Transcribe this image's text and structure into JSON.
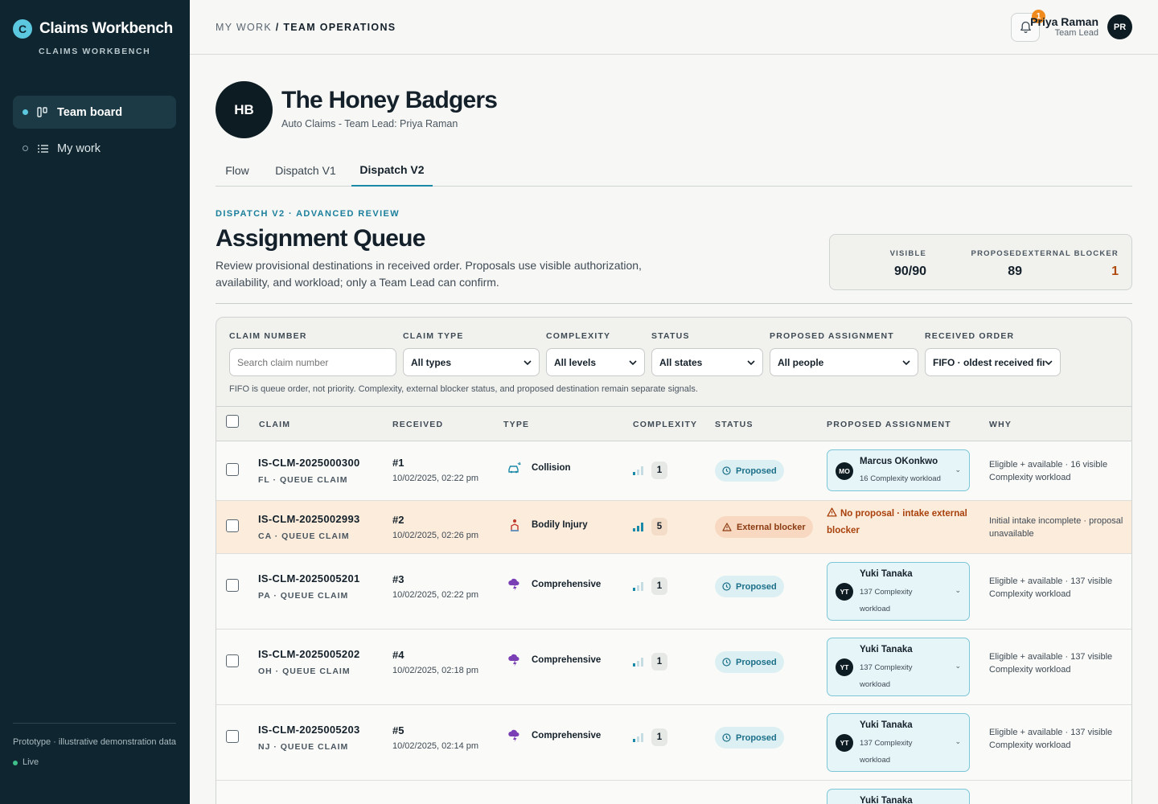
{
  "app": {
    "logo_letter": "C",
    "title": "Claims Workbench",
    "subtitle": "CLAIMS WORKBENCH"
  },
  "sidebar": {
    "items": [
      {
        "label": "Team board",
        "icon": "board-icon",
        "active": true
      },
      {
        "label": "My work",
        "icon": "list-icon",
        "active": false
      }
    ],
    "footer_note": "Prototype · illustrative demonstration data",
    "status": "Live"
  },
  "topbar": {
    "crumb_root": "MY WORK",
    "crumb_sep": " / ",
    "crumb_current": "TEAM OPERATIONS",
    "notifications": "1",
    "user_name": "Priya Raman",
    "user_role": "Team Lead",
    "user_initials": "PR"
  },
  "team": {
    "initials": "HB",
    "name": "The Honey Badgers",
    "subtitle": "Auto Claims - Team Lead: Priya Raman"
  },
  "tabs": [
    {
      "label": "Flow"
    },
    {
      "label": "Dispatch V1"
    },
    {
      "label": "Dispatch V2",
      "active": true
    }
  ],
  "section": {
    "eyebrow": "DISPATCH V2 · ADVANCED REVIEW",
    "title": "Assignment Queue",
    "description": "Review provisional destinations in received order. Proposals use visible authorization, availability, and workload; only a Team Lead can confirm."
  },
  "stats": [
    {
      "label": "VISIBLE",
      "value": "90/90",
      "color": "#14202a"
    },
    {
      "label": "PROPOSED",
      "value": "89",
      "color": "#14202a"
    },
    {
      "label": "EXTERNAL BLOCKER",
      "value": "1",
      "color": "#b04a0c"
    }
  ],
  "filters": {
    "claim_number": {
      "label": "CLAIM NUMBER",
      "placeholder": "Search claim number"
    },
    "claim_type": {
      "label": "CLAIM TYPE",
      "value": "All types"
    },
    "complexity": {
      "label": "COMPLEXITY",
      "value": "All levels"
    },
    "status": {
      "label": "STATUS",
      "value": "All states"
    },
    "proposed": {
      "label": "PROPOSED ASSIGNMENT",
      "value": "All people"
    },
    "order": {
      "label": "RECEIVED ORDER",
      "value": "FIFO · oldest received fir"
    },
    "note": "FIFO is queue order, not priority. Complexity, external blocker status, and proposed destination remain separate signals."
  },
  "table": {
    "headers": [
      "CLAIM",
      "RECEIVED",
      "TYPE",
      "COMPLEXITY",
      "STATUS",
      "PROPOSED ASSIGNMENT",
      "WHY"
    ],
    "rows": [
      {
        "claim": "IS-CLM-2025000300",
        "sub": "FL · QUEUE CLAIM",
        "num": "#1",
        "date": "10/02/2025, 02:22 pm",
        "type": "Collision",
        "type_icon": "car-icon",
        "complexity": "1",
        "status": "Proposed",
        "assignee": "Marcus OKonkwo",
        "initials": "MO",
        "load": "16 Complexity workload",
        "why": "Eligible + available · 16 visible\nComplexity workload"
      },
      {
        "claim": "IS-CLM-2025002993",
        "sub": "CA · QUEUE CLAIM",
        "num": "#2",
        "date": "10/02/2025, 02:26 pm",
        "type": "Bodily Injury",
        "type_icon": "injury-icon",
        "complexity": "5",
        "status": "External blocker",
        "note": "No proposal · intake external blocker",
        "why": "Initial intake incomplete · proposal\nunavailable"
      },
      {
        "claim": "IS-CLM-2025005201",
        "sub": "PA · QUEUE CLAIM",
        "num": "#3",
        "date": "10/02/2025, 02:22 pm",
        "type": "Comprehensive",
        "type_icon": "storm-icon",
        "complexity": "1",
        "status": "Proposed",
        "assignee": "Yuki Tanaka",
        "initials": "YT",
        "load": "137 Complexity workload",
        "why": "Eligible + available · 137 visible\nComplexity workload"
      },
      {
        "claim": "IS-CLM-2025005202",
        "sub": "OH · QUEUE CLAIM",
        "num": "#4",
        "date": "10/02/2025, 02:18 pm",
        "type": "Comprehensive",
        "type_icon": "storm-icon",
        "complexity": "1",
        "status": "Proposed",
        "assignee": "Yuki Tanaka",
        "initials": "YT",
        "load": "137 Complexity workload",
        "why": "Eligible + available · 137 visible\nComplexity workload"
      },
      {
        "claim": "IS-CLM-2025005203",
        "sub": "NJ · QUEUE CLAIM",
        "num": "#5",
        "date": "10/02/2025, 02:14 pm",
        "type": "Comprehensive",
        "type_icon": "storm-icon",
        "complexity": "1",
        "status": "Proposed",
        "assignee": "Yuki Tanaka",
        "initials": "YT",
        "load": "137 Complexity workload",
        "why": "Eligible + available · 137 visible\nComplexity workload"
      },
      {
        "assignee": "Yuki Tanaka"
      }
    ]
  }
}
